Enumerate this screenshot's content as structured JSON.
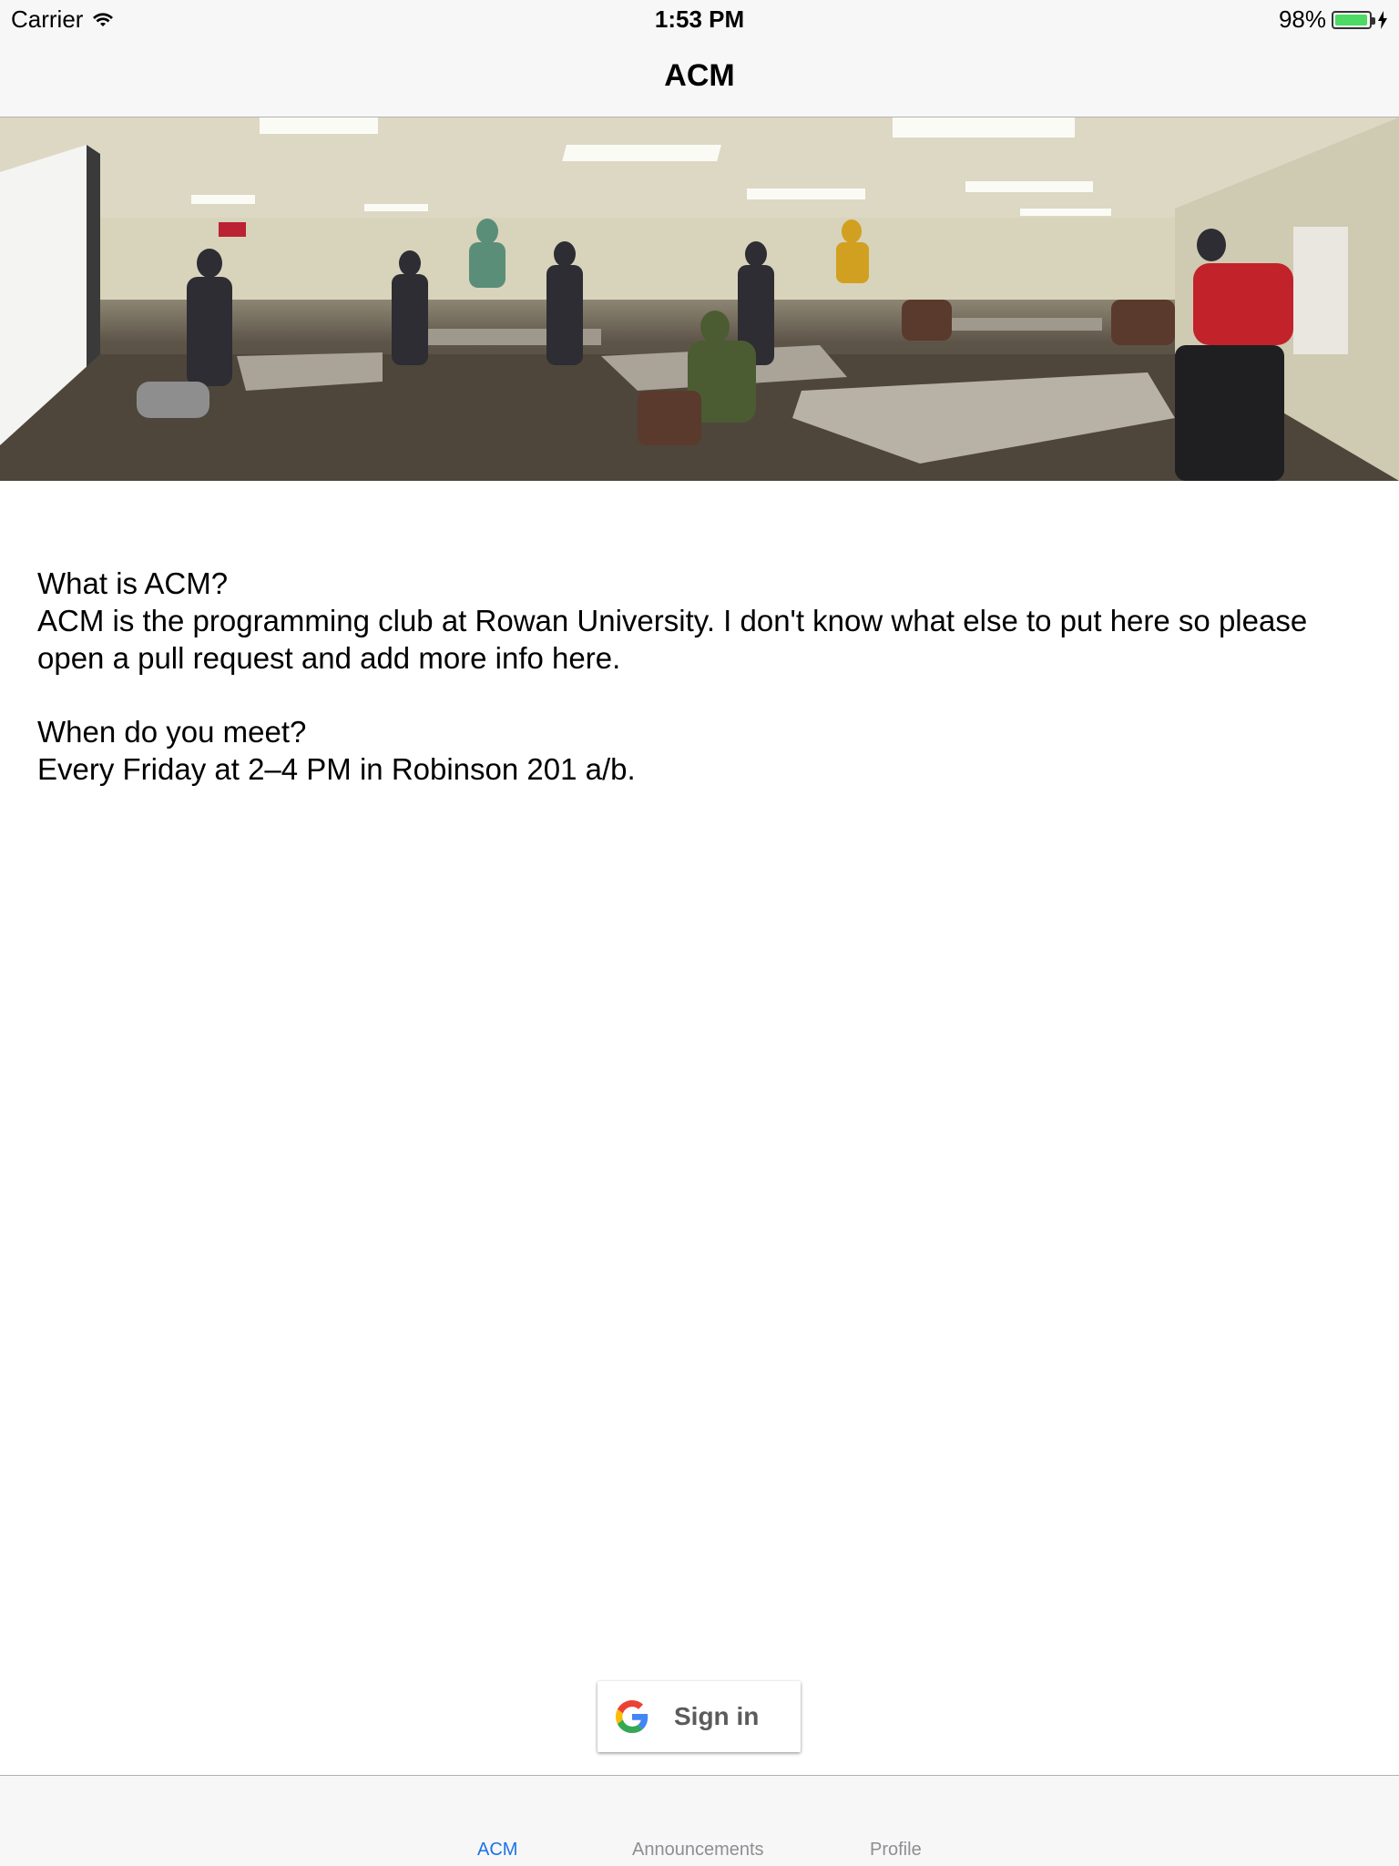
{
  "status_bar": {
    "carrier": "Carrier",
    "time": "1:53 PM",
    "battery_percent": "98%",
    "battery_level": 0.98,
    "battery_color": "#4cd964"
  },
  "nav": {
    "title": "ACM"
  },
  "hero_image": {
    "description_icon": "classroom-photo"
  },
  "content": {
    "q1": "What is ACM?",
    "a1": "ACM is the programming club at Rowan University. I don't know what else to put here so please open a pull request and add more info here.",
    "q2": "When do you meet?",
    "a2": "Every Friday at 2–4 PM in Robinson 201 a/b."
  },
  "signin": {
    "label": "Sign in",
    "icon": "google-icon"
  },
  "tabs": [
    {
      "label": "ACM",
      "active": true
    },
    {
      "label": "Announcements",
      "active": false
    },
    {
      "label": "Profile",
      "active": false
    }
  ],
  "colors": {
    "tab_active": "#1a73e8",
    "tab_inactive": "#8e8e93",
    "bar_background": "#f7f7f7"
  }
}
